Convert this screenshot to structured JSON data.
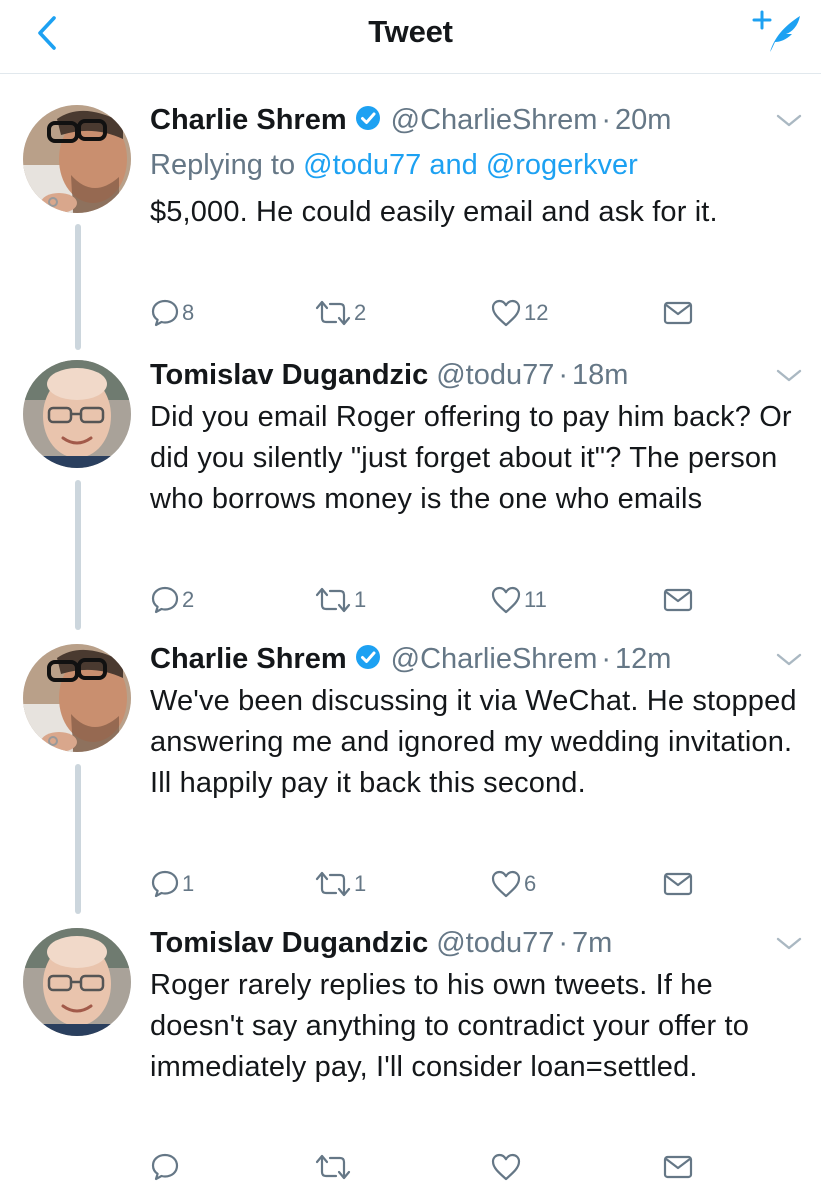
{
  "nav": {
    "title": "Tweet",
    "back_icon": "chevron-left-icon",
    "compose_icon": "compose-tweet-icon",
    "accent": "#1da1f2"
  },
  "colors": {
    "accent": "#1da1f2",
    "text": "#14171a",
    "secondary": "#657786",
    "thread_line": "#ccd6dd"
  },
  "tweets": [
    {
      "name": "Charlie Shrem",
      "verified": true,
      "handle": "@CharlieShrem",
      "time": "20m",
      "replying_label": "Replying to",
      "replying_to": [
        "@todu77",
        "@rogerkver"
      ],
      "replying_and": "and",
      "text": "$5,000. He could easily email and ask for it.",
      "reply_count": "8",
      "retweet_count": "2",
      "like_count": "12"
    },
    {
      "name": "Tomislav Dugandzic",
      "verified": false,
      "handle": "@todu77",
      "time": "18m",
      "text": "Did you email Roger offering to pay him back? Or did you silently \"just forget about it\"? The person who borrows money is the one who emails",
      "reply_count": "2",
      "retweet_count": "1",
      "like_count": "11"
    },
    {
      "name": "Charlie Shrem",
      "verified": true,
      "handle": "@CharlieShrem",
      "time": "12m",
      "text": "We've been discussing it via WeChat. He stopped answering me and ignored my wedding invitation. Ill happily pay it back this second.",
      "reply_count": "1",
      "retweet_count": "1",
      "like_count": "6"
    },
    {
      "name": "Tomislav Dugandzic",
      "verified": false,
      "handle": "@todu77",
      "time": "7m",
      "text": "Roger rarely replies to his own tweets. If he doesn't say anything to contradict your offer to immediately pay, I'll consider loan=settled.",
      "reply_count": "",
      "retweet_count": "",
      "like_count": ""
    }
  ],
  "separator": "·",
  "icons": {
    "reply": "reply-icon",
    "retweet": "retweet-icon",
    "like": "heart-icon",
    "dm": "envelope-icon",
    "more": "chevron-down-icon",
    "verified": "verified-badge-icon"
  }
}
